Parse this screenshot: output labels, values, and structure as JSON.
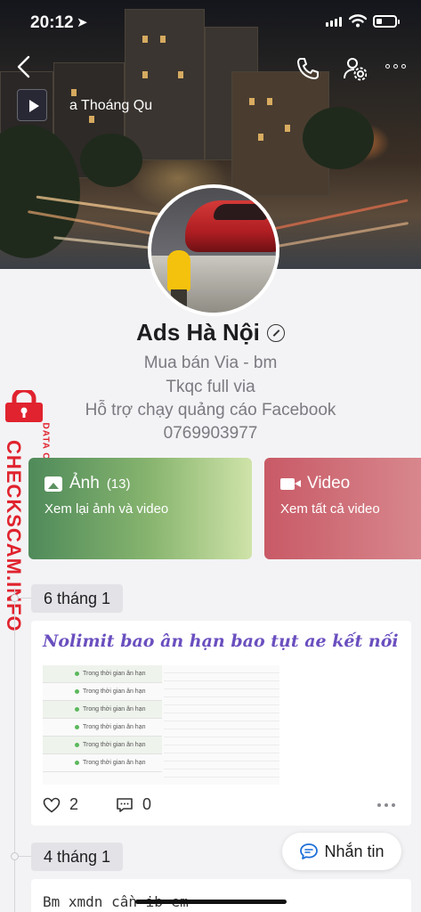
{
  "status_bar": {
    "time": "20:12"
  },
  "cover": {
    "music_title": "a Thoáng Qu"
  },
  "profile": {
    "name": "Ads Hà Nội",
    "bio": [
      "Mua bán Via - bm",
      "Tkqc full via",
      "Hỗ trợ chạy quảng cáo Facebook",
      "0769903977"
    ]
  },
  "watermark": {
    "brand": "CHECKSCAM.INFO",
    "sub": "DATA CENTER"
  },
  "media": {
    "photos": {
      "label": "Ảnh",
      "count": "(13)",
      "subtitle": "Xem lại ảnh và video"
    },
    "video": {
      "label": "Video",
      "subtitle": "Xem tất cả video"
    }
  },
  "timeline": {
    "posts": [
      {
        "date": "6 tháng 1",
        "title": "Nolimit bao ân hạn bao tụt ae kết nối",
        "likes": "2",
        "comments": "0",
        "image_rows": [
          "Trong thời gian ân hạn",
          "Trong thời gian ân hạn",
          "Trong thời gian ân hạn",
          "Trong thời gian ân hạn",
          "Trong thời gian ân hạn",
          "Trong thời gian ân hạn"
        ]
      },
      {
        "date": "4 tháng 1",
        "text": "Bm xmdn cần ib em"
      }
    ]
  },
  "message_button": {
    "label": "Nhắn tin"
  },
  "colors": {
    "accent_purple": "#6a4fbf",
    "photo_card": "#5c9160",
    "video_card": "#c85a66",
    "watermark_red": "#e0232e"
  }
}
